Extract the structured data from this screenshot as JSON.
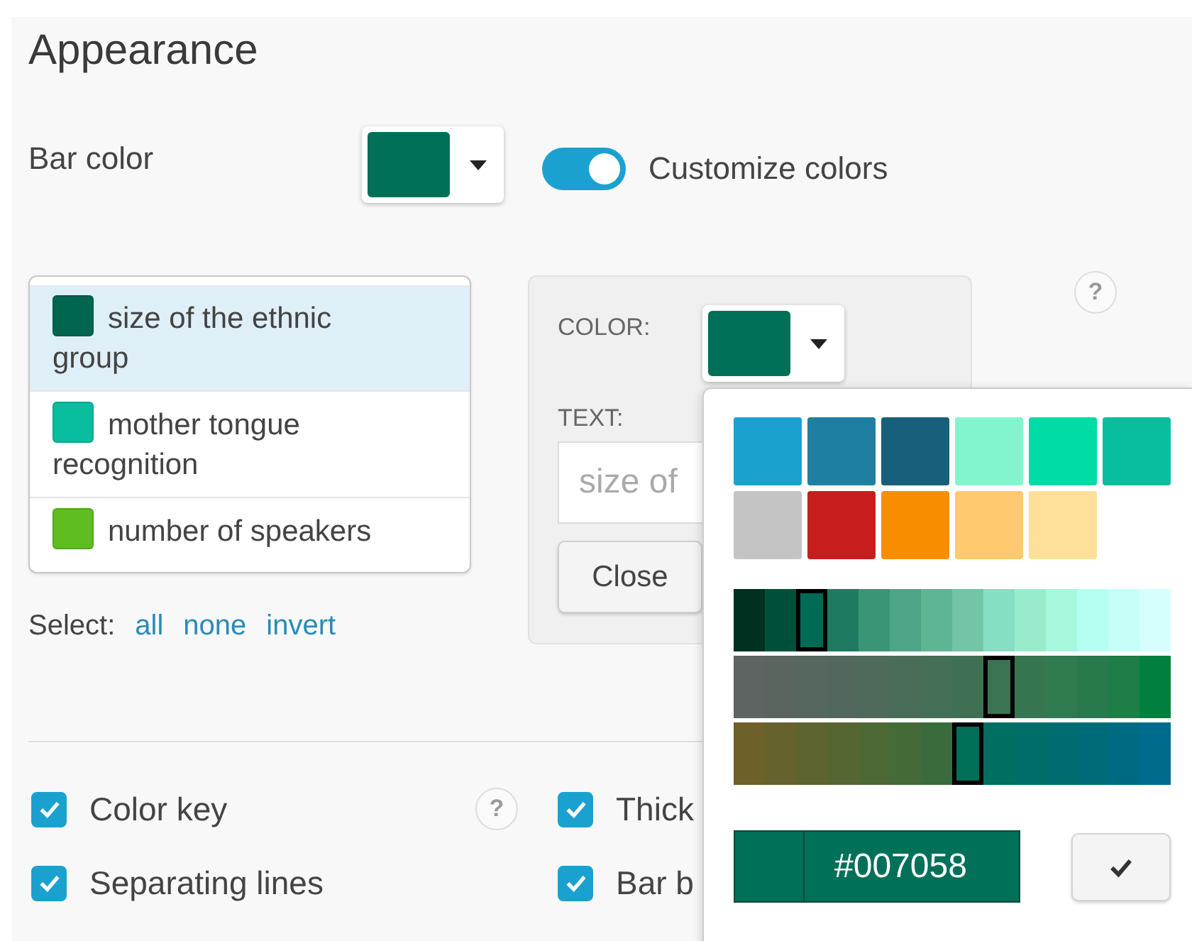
{
  "title": "Appearance",
  "bar_color": {
    "label": "Bar color",
    "color": "#006f57"
  },
  "customize_toggle": {
    "label": "Customize colors",
    "on": true
  },
  "series": [
    {
      "label": "size of the ethnic group",
      "color": "#00664e",
      "selected": true
    },
    {
      "label": "mother tongue recognition",
      "color": "#09bd9f",
      "selected": false
    },
    {
      "label": "number of speakers",
      "color": "#5fbc21",
      "selected": false
    }
  ],
  "select": {
    "label": "Select:",
    "links": [
      "all",
      "none",
      "invert"
    ]
  },
  "editor": {
    "color_label": "COLOR:",
    "color": "#006f57",
    "text_label": "TEXT:",
    "text_placeholder": "size of",
    "close": "Close"
  },
  "help": "?",
  "options": [
    {
      "label": "Color key",
      "checked": true,
      "help": "?"
    },
    {
      "label": "Thick",
      "checked": true
    },
    {
      "label": "Separating lines",
      "checked": true
    },
    {
      "label": "Bar b",
      "checked": true
    }
  ],
  "color_picker": {
    "palette": [
      {
        "color": "#1ba1d0",
        "selected": false
      },
      {
        "color": "#1e7fa2",
        "selected": false
      },
      {
        "color": "#185f7c",
        "selected": false
      },
      {
        "color": "#82f5cf",
        "selected": false
      },
      {
        "color": "#00dca6",
        "selected": false
      },
      {
        "color": "#09bd9f",
        "selected": false
      },
      {
        "color": "#c4c4c4",
        "selected": false
      },
      {
        "color": "#c81d1d",
        "selected": false
      },
      {
        "color": "#f88d00",
        "selected": false
      },
      {
        "color": "#fec96f",
        "selected": false
      },
      {
        "color": "#ffe09a",
        "selected": false
      }
    ],
    "gradients": [
      {
        "cells": [
          {
            "color": "#00301f",
            "selected": false
          },
          {
            "color": "#004f3a",
            "selected": false
          },
          {
            "color": "#006b55",
            "selected": true
          },
          {
            "color": "#1f7a62",
            "selected": false
          },
          {
            "color": "#3a9577",
            "selected": false
          },
          {
            "color": "#4ea486",
            "selected": false
          },
          {
            "color": "#5db594",
            "selected": false
          },
          {
            "color": "#72c5a6",
            "selected": false
          },
          {
            "color": "#86dfc2",
            "selected": false
          },
          {
            "color": "#98eccc",
            "selected": false
          },
          {
            "color": "#a6f8dc",
            "selected": false
          },
          {
            "color": "#b5fff0",
            "selected": false
          },
          {
            "color": "#c6fff5",
            "selected": false
          },
          {
            "color": "#d6fffc",
            "selected": false
          }
        ]
      },
      {
        "cells": [
          {
            "color": "#5e6462",
            "selected": false
          },
          {
            "color": "#5a6560",
            "selected": false
          },
          {
            "color": "#56675e",
            "selected": false
          },
          {
            "color": "#52685c",
            "selected": false
          },
          {
            "color": "#4e6a5a",
            "selected": false
          },
          {
            "color": "#496c58",
            "selected": false
          },
          {
            "color": "#446e56",
            "selected": false
          },
          {
            "color": "#407054",
            "selected": false
          },
          {
            "color": "#3b7452",
            "selected": true
          },
          {
            "color": "#357651",
            "selected": false
          },
          {
            "color": "#2f7a4f",
            "selected": false
          },
          {
            "color": "#28794c",
            "selected": false
          },
          {
            "color": "#1f7d47",
            "selected": false
          },
          {
            "color": "#007f3e",
            "selected": false
          }
        ]
      },
      {
        "cells": [
          {
            "color": "#6e6029",
            "selected": false
          },
          {
            "color": "#66622d",
            "selected": false
          },
          {
            "color": "#5e642f",
            "selected": false
          },
          {
            "color": "#556632",
            "selected": false
          },
          {
            "color": "#4c6835",
            "selected": false
          },
          {
            "color": "#446a38",
            "selected": false
          },
          {
            "color": "#3a6b3c",
            "selected": false
          },
          {
            "color": "#006f57",
            "selected": true
          },
          {
            "color": "#006e60",
            "selected": false
          },
          {
            "color": "#006d68",
            "selected": false
          },
          {
            "color": "#006c70",
            "selected": false
          },
          {
            "color": "#006b78",
            "selected": false
          },
          {
            "color": "#006a82",
            "selected": false
          },
          {
            "color": "#006b8c",
            "selected": false
          }
        ]
      }
    ],
    "hex_value": "#007058"
  }
}
